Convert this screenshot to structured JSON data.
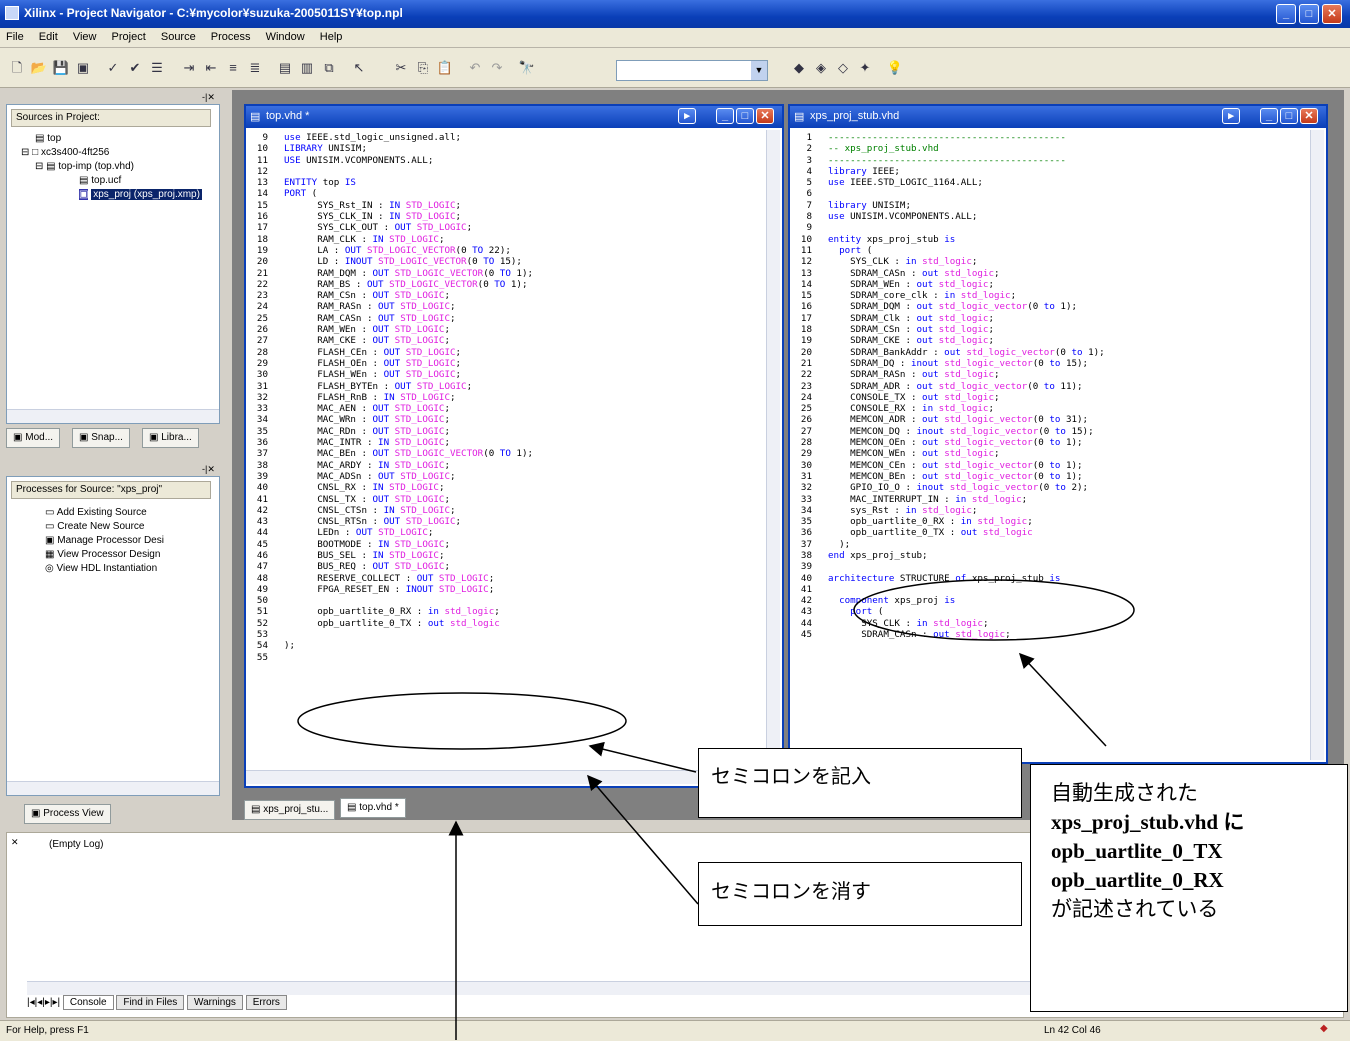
{
  "window": {
    "title": "Xilinx - Project Navigator - C:¥mycolor¥suzuka-2005011SY¥top.npl"
  },
  "menu": [
    "File",
    "Edit",
    "View",
    "Project",
    "Source",
    "Process",
    "Window",
    "Help"
  ],
  "toolbar": {
    "combo_value": ""
  },
  "sources_panel": {
    "header": "Sources in Project:",
    "tree": [
      "top",
      "xc3s400-4ft256",
      "top-imp (top.vhd)",
      "top.ucf",
      "xps_proj (xps_proj.xmp)"
    ],
    "tabs": [
      "Mod...",
      "Snap...",
      "Libra..."
    ]
  },
  "processes_panel": {
    "header": "Processes for Source: \"xps_proj\"",
    "items": [
      "Add Existing Source",
      "Create New Source",
      "Manage Processor Desi",
      "View Processor Design",
      "View HDL Instantiation"
    ],
    "tab": "Process View"
  },
  "editor_left": {
    "title": "top.vhd *",
    "lines": [
      {
        "n": "9",
        "t": "use IEEE.std_logic_unsigned.all;"
      },
      {
        "n": "10",
        "t": "LIBRARY UNISIM;"
      },
      {
        "n": "11",
        "t": "USE UNISIM.VCOMPONENTS.ALL;"
      },
      {
        "n": "12",
        "t": ""
      },
      {
        "n": "13",
        "t": "ENTITY top IS"
      },
      {
        "n": "14",
        "t": "PORT ("
      },
      {
        "n": "15",
        "t": "      SYS_Rst_IN : IN STD_LOGIC;"
      },
      {
        "n": "16",
        "t": "      SYS_CLK_IN : IN STD_LOGIC;"
      },
      {
        "n": "17",
        "t": "      SYS_CLK_OUT : OUT STD_LOGIC;"
      },
      {
        "n": "18",
        "t": "      RAM_CLK : IN STD_LOGIC;"
      },
      {
        "n": "19",
        "t": "      LA : OUT STD_LOGIC_VECTOR(0 TO 22);"
      },
      {
        "n": "20",
        "t": "      LD : INOUT STD_LOGIC_VECTOR(0 TO 15);"
      },
      {
        "n": "21",
        "t": "      RAM_DQM : OUT STD_LOGIC_VECTOR(0 TO 1);"
      },
      {
        "n": "22",
        "t": "      RAM_BS : OUT STD_LOGIC_VECTOR(0 TO 1);"
      },
      {
        "n": "23",
        "t": "      RAM_CSn : OUT STD_LOGIC;"
      },
      {
        "n": "24",
        "t": "      RAM_RASn : OUT STD_LOGIC;"
      },
      {
        "n": "25",
        "t": "      RAM_CASn : OUT STD_LOGIC;"
      },
      {
        "n": "26",
        "t": "      RAM_WEn : OUT STD_LOGIC;"
      },
      {
        "n": "27",
        "t": "      RAM_CKE : OUT STD_LOGIC;"
      },
      {
        "n": "28",
        "t": "      FLASH_CEn : OUT STD_LOGIC;"
      },
      {
        "n": "29",
        "t": "      FLASH_OEn : OUT STD_LOGIC;"
      },
      {
        "n": "30",
        "t": "      FLASH_WEn : OUT STD_LOGIC;"
      },
      {
        "n": "31",
        "t": "      FLASH_BYTEn : OUT STD_LOGIC;"
      },
      {
        "n": "32",
        "t": "      FLASH_RnB : IN STD_LOGIC;"
      },
      {
        "n": "33",
        "t": "      MAC_AEN : OUT STD_LOGIC;"
      },
      {
        "n": "34",
        "t": "      MAC_WRn : OUT STD_LOGIC;"
      },
      {
        "n": "35",
        "t": "      MAC_RDn : OUT STD_LOGIC;"
      },
      {
        "n": "36",
        "t": "      MAC_INTR : IN STD_LOGIC;"
      },
      {
        "n": "37",
        "t": "      MAC_BEn : OUT STD_LOGIC_VECTOR(0 TO 1);"
      },
      {
        "n": "38",
        "t": "      MAC_ARDY : IN STD_LOGIC;"
      },
      {
        "n": "39",
        "t": "      MAC_ADSn : OUT STD_LOGIC;"
      },
      {
        "n": "40",
        "t": "      CNSL_RX : IN STD_LOGIC;"
      },
      {
        "n": "41",
        "t": "      CNSL_TX : OUT STD_LOGIC;"
      },
      {
        "n": "42",
        "t": "      CNSL_CTSn : IN STD_LOGIC;"
      },
      {
        "n": "43",
        "t": "      CNSL_RTSn : OUT STD_LOGIC;"
      },
      {
        "n": "44",
        "t": "      LEDn : OUT STD_LOGIC;"
      },
      {
        "n": "45",
        "t": "      BOOTMODE : IN STD_LOGIC;"
      },
      {
        "n": "46",
        "t": "      BUS_SEL : IN STD_LOGIC;"
      },
      {
        "n": "47",
        "t": "      BUS_REQ : OUT STD_LOGIC;"
      },
      {
        "n": "48",
        "t": "      RESERVE_COLLECT : OUT STD_LOGIC;"
      },
      {
        "n": "49",
        "t": "      FPGA_RESET_EN : INOUT STD_LOGIC;"
      },
      {
        "n": "50",
        "t": ""
      },
      {
        "n": "51",
        "t": "      opb_uartlite_0_RX : in std_logic;"
      },
      {
        "n": "52",
        "t": "      opb_uartlite_0_TX : out std_logic"
      },
      {
        "n": "53",
        "t": ""
      },
      {
        "n": "54",
        "t": ");"
      },
      {
        "n": "55",
        "t": ""
      }
    ]
  },
  "editor_right": {
    "title": "xps_proj_stub.vhd",
    "lines": [
      {
        "n": "1",
        "t": "-------------------------------------------"
      },
      {
        "n": "2",
        "t": "-- xps_proj_stub.vhd"
      },
      {
        "n": "3",
        "t": "-------------------------------------------"
      },
      {
        "n": "4",
        "t": "library IEEE;"
      },
      {
        "n": "5",
        "t": "use IEEE.STD_LOGIC_1164.ALL;"
      },
      {
        "n": "6",
        "t": ""
      },
      {
        "n": "7",
        "t": "library UNISIM;"
      },
      {
        "n": "8",
        "t": "use UNISIM.VCOMPONENTS.ALL;"
      },
      {
        "n": "9",
        "t": ""
      },
      {
        "n": "10",
        "t": "entity xps_proj_stub is"
      },
      {
        "n": "11",
        "t": "  port ("
      },
      {
        "n": "12",
        "t": "    SYS_CLK : in std_logic;"
      },
      {
        "n": "13",
        "t": "    SDRAM_CASn : out std_logic;"
      },
      {
        "n": "14",
        "t": "    SDRAM_WEn : out std_logic;"
      },
      {
        "n": "15",
        "t": "    SDRAM_core_clk : in std_logic;"
      },
      {
        "n": "16",
        "t": "    SDRAM_DQM : out std_logic_vector(0 to 1);"
      },
      {
        "n": "17",
        "t": "    SDRAM_Clk : out std_logic;"
      },
      {
        "n": "18",
        "t": "    SDRAM_CSn : out std_logic;"
      },
      {
        "n": "19",
        "t": "    SDRAM_CKE : out std_logic;"
      },
      {
        "n": "20",
        "t": "    SDRAM_BankAddr : out std_logic_vector(0 to 1);"
      },
      {
        "n": "21",
        "t": "    SDRAM_DQ : inout std_logic_vector(0 to 15);"
      },
      {
        "n": "22",
        "t": "    SDRAM_RASn : out std_logic;"
      },
      {
        "n": "23",
        "t": "    SDRAM_ADR : out std_logic_vector(0 to 11);"
      },
      {
        "n": "24",
        "t": "    CONSOLE_TX : out std_logic;"
      },
      {
        "n": "25",
        "t": "    CONSOLE_RX : in std_logic;"
      },
      {
        "n": "26",
        "t": "    MEMCON_ADR : out std_logic_vector(0 to 31);"
      },
      {
        "n": "27",
        "t": "    MEMCON_DQ : inout std_logic_vector(0 to 15);"
      },
      {
        "n": "28",
        "t": "    MEMCON_OEn : out std_logic_vector(0 to 1);"
      },
      {
        "n": "29",
        "t": "    MEMCON_WEn : out std_logic;"
      },
      {
        "n": "30",
        "t": "    MEMCON_CEn : out std_logic_vector(0 to 1);"
      },
      {
        "n": "31",
        "t": "    MEMCON_BEn : out std_logic_vector(0 to 1);"
      },
      {
        "n": "32",
        "t": "    GPIO_IO_O : inout std_logic_vector(0 to 2);"
      },
      {
        "n": "33",
        "t": "    MAC_INTERRUPT_IN : in std_logic;"
      },
      {
        "n": "34",
        "t": "    sys_Rst : in std_logic;"
      },
      {
        "n": "35",
        "t": "    opb_uartlite_0_RX : in std_logic;"
      },
      {
        "n": "36",
        "t": "    opb_uartlite_0_TX : out std_logic"
      },
      {
        "n": "37",
        "t": "  );"
      },
      {
        "n": "38",
        "t": "end xps_proj_stub;"
      },
      {
        "n": "39",
        "t": ""
      },
      {
        "n": "40",
        "t": "architecture STRUCTURE of xps_proj_stub is"
      },
      {
        "n": "41",
        "t": ""
      },
      {
        "n": "42",
        "t": "  component xps_proj is"
      },
      {
        "n": "43",
        "t": "    port ("
      },
      {
        "n": "44",
        "t": "      SYS_CLK : in std_logic;"
      },
      {
        "n": "45",
        "t": "      SDRAM_CASn : out std_logic;"
      }
    ]
  },
  "editor_tabs": [
    "xps_proj_stu...",
    "top.vhd *"
  ],
  "console": {
    "text": "(Empty Log)",
    "tabs": [
      "Console",
      "Find in Files",
      "Warnings",
      "Errors"
    ]
  },
  "status": {
    "left": "For Help, press F1",
    "position": "Ln 42 Col 46"
  },
  "callouts": {
    "add_semicolon": "セミコロンを記入",
    "remove_semicolon": "セミコロンを消す",
    "note_lines": [
      "自動生成された",
      "xps_proj_stub.vhd に",
      "opb_uartlite_0_TX",
      "opb_uartlite_0_RX",
      "が記述されている"
    ]
  }
}
